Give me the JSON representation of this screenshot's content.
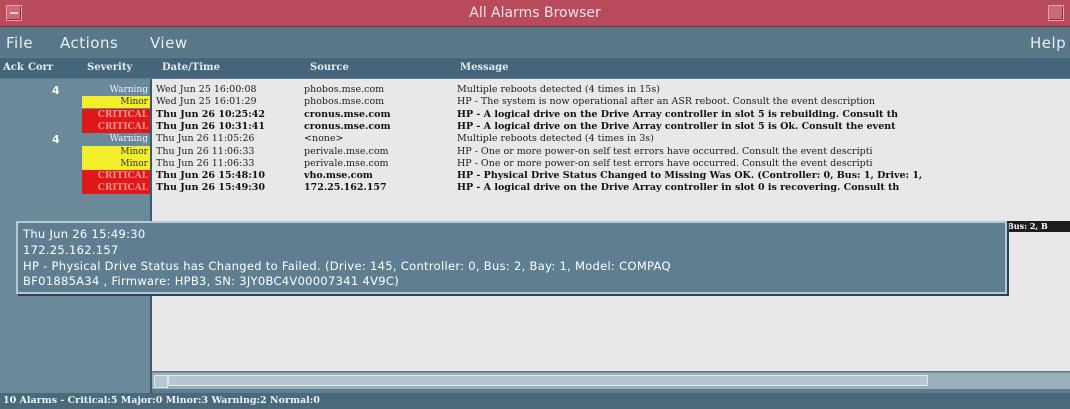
{
  "window": {
    "title": "All Alarms Browser"
  },
  "menu": {
    "file": "File",
    "actions": "Actions",
    "view": "View",
    "help": "Help"
  },
  "columns": {
    "ack": "Ack",
    "corr": "Corr",
    "severity": "Severity",
    "datetime": "Date/Time",
    "source": "Source",
    "message": "Message"
  },
  "severity_colors": {
    "warning": "#5d7d90",
    "minor": "#f3ee2a",
    "critical": "#e01818"
  },
  "alarms": [
    {
      "corr": "4",
      "severity": "Warning",
      "date": "Wed Jun 25 16:00:08",
      "source": "phobos.mse.com",
      "message": "Multiple reboots detected (4 times in 15s)"
    },
    {
      "corr": "",
      "severity": "Minor",
      "date": "Wed Jun 25 16:01:29",
      "source": "phobos.mse.com",
      "message": "HP - The system is now operational after an ASR reboot.  Consult the event description"
    },
    {
      "corr": "",
      "severity": "CRITICAL",
      "date": "Thu Jun 26 10:25:42",
      "source": "cronus.mse.com",
      "message": "HP - A logical drive on the Drive Array controller in slot 5 is rebuilding.  Consult th"
    },
    {
      "corr": "",
      "severity": "CRITICAL",
      "date": "Thu Jun 26 10:31:41",
      "source": "cronus.mse.com",
      "message": "HP - A logical drive on the Drive Array controller in slot 5 is Ok.  Consult the event"
    },
    {
      "corr": "4",
      "severity": "Warning",
      "date": "Thu Jun 26 11:05:26",
      "source": "<none>",
      "message": "Multiple reboots detected (4 times in 3s)"
    },
    {
      "corr": "",
      "severity": "Minor",
      "date": "Thu Jun 26 11:06:33",
      "source": "perivale.mse.com",
      "message": "HP - One or more power-on self test errors have occurred.  Consult the event descripti"
    },
    {
      "corr": "",
      "severity": "Minor",
      "date": "Thu Jun 26 11:06:33",
      "source": "perivale.mse.com",
      "message": "HP - One or more power-on self test errors have occurred.  Consult the event descripti"
    },
    {
      "corr": "",
      "severity": "CRITICAL",
      "date": "Thu Jun 26 15:48:10",
      "source": "vho.mse.com",
      "message": "HP - Physical Drive Status Changed to Missing Was OK. (Controller: 0, Bus: 1, Drive: 1,"
    },
    {
      "corr": "",
      "severity": "CRITICAL",
      "date": "Thu Jun 26 15:49:30",
      "source": "172.25.162.157",
      "message": "HP - A logical drive on the Drive Array controller in slot 0 is recovering.  Consult th"
    }
  ],
  "hidden_row_fragment": "Bus: 2, B",
  "tooltip": {
    "line1": "Thu Jun 26 15:49:30",
    "line2": "172.25.162.157",
    "line3": "HP - Physical Drive Status has Changed to Failed. (Drive: 145, Controller: 0, Bus: 2, Bay: 1, Model: COMPAQ",
    "line4": "BF01885A34      , Firmware: HPB3, SN: 3JY0BC4V00007341 4V9C)"
  },
  "status": "10 Alarms -  Critical:5  Major:0  Minor:3  Warning:2  Normal:0"
}
